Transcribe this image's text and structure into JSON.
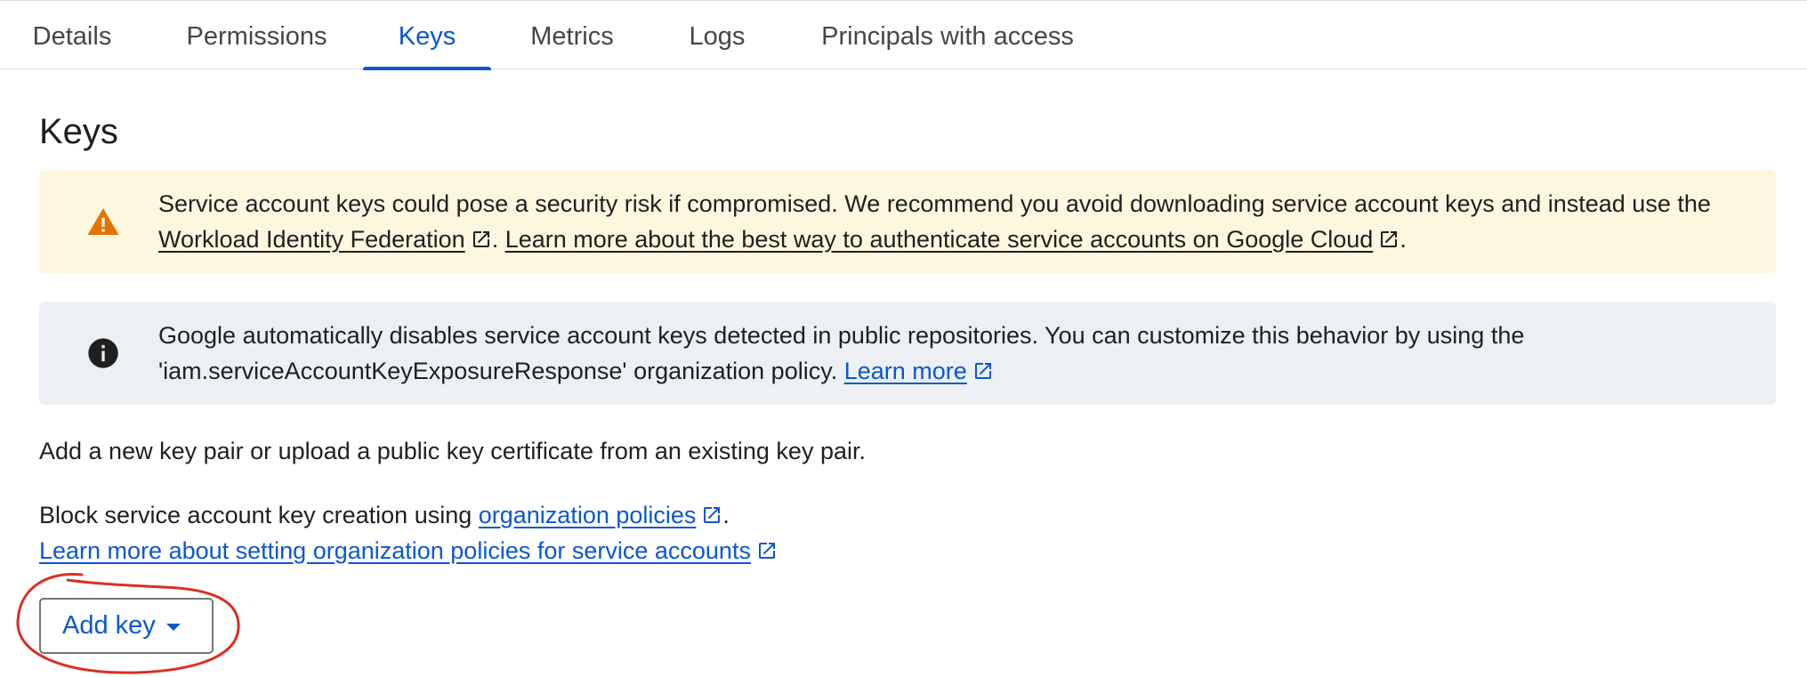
{
  "tabs": [
    {
      "label": "Details"
    },
    {
      "label": "Permissions"
    },
    {
      "label": "Keys"
    },
    {
      "label": "Metrics"
    },
    {
      "label": "Logs"
    },
    {
      "label": "Principals with access"
    }
  ],
  "active_tab": "Keys",
  "page_title": "Keys",
  "warning_banner": {
    "icon": "warning-icon",
    "text_before": "Service account keys could pose a security risk if compromised. We recommend you avoid downloading service account keys and instead use the ",
    "link1": "Workload Identity Federation",
    "text_between": ". ",
    "link2": "Learn more about the best way to authenticate service accounts on Google Cloud",
    "text_after": "."
  },
  "info_banner": {
    "icon": "info-icon",
    "text_before": "Google automatically disables service account keys detected in public repositories. You can customize this behavior by using the 'iam.serviceAccountKeyExposureResponse' organization policy. ",
    "link": "Learn more"
  },
  "intro_text": "Add a new key pair or upload a public key certificate from an existing key pair.",
  "block_text_before": "Block service account key creation using ",
  "block_link": "organization policies",
  "block_text_after": ".",
  "learn_more_policies": "Learn more about setting organization policies for service accounts",
  "add_key_button": "Add key",
  "colors": {
    "accent": "#0b57d0",
    "warning_bg": "#fef7e0",
    "warning_icon": "#e37400",
    "info_bg": "#eceff3",
    "annotation": "#d93025"
  }
}
